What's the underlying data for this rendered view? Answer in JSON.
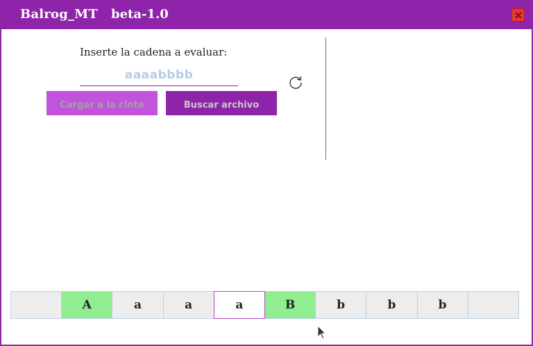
{
  "window": {
    "title": "Balrog_MT",
    "version": "beta-1.0"
  },
  "form": {
    "prompt": "Inserte la cadena a evaluar:",
    "input_placeholder": "aaaabbbb",
    "input_value": "",
    "load_button": "Cargar a la cinta",
    "file_button": "Buscar archivo"
  },
  "tape": {
    "cells": [
      {
        "symbol": "",
        "type": "blank"
      },
      {
        "symbol": "A",
        "type": "upper"
      },
      {
        "symbol": "a",
        "type": "normal"
      },
      {
        "symbol": "a",
        "type": "normal"
      },
      {
        "symbol": "a",
        "type": "head"
      },
      {
        "symbol": "B",
        "type": "upper"
      },
      {
        "symbol": "b",
        "type": "normal"
      },
      {
        "symbol": "b",
        "type": "normal"
      },
      {
        "symbol": "b",
        "type": "normal"
      },
      {
        "symbol": "",
        "type": "blank"
      }
    ],
    "head_index": 4
  },
  "icons": {
    "close": "close-icon",
    "refresh": "refresh-icon",
    "cursor": "mouse-pointer-icon"
  },
  "colors": {
    "accent": "#8e24aa",
    "accent_light": "#c154dc",
    "marked_cell": "#90ee90",
    "cell": "#ededed",
    "close": "#e53935"
  }
}
